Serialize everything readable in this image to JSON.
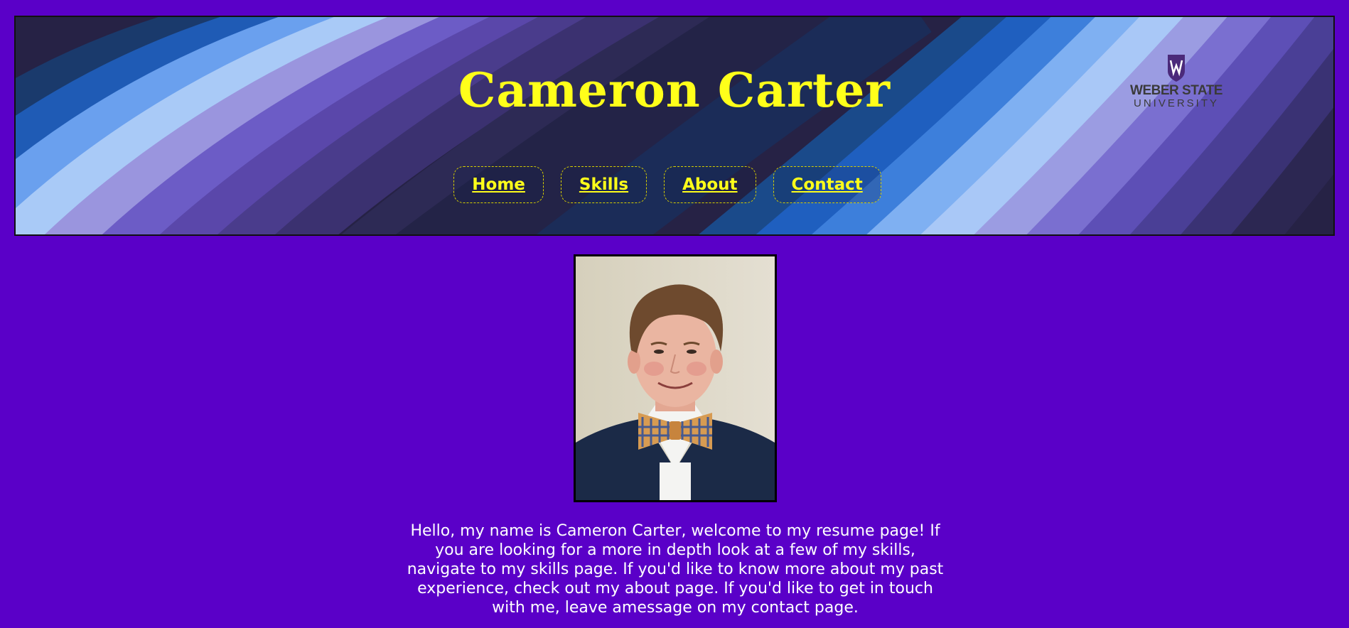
{
  "header": {
    "title": "Cameron Carter",
    "logo": {
      "line1": "WEBER STATE",
      "line2": "UNIVERSITY"
    }
  },
  "nav": {
    "home": "Home",
    "skills": "Skills",
    "about": "About",
    "contact": "Contact"
  },
  "intro": {
    "text": "Hello, my name is Cameron Carter, welcome to my resume page! If you are looking for a more in depth look at a few of my skills, navigate to my skills page. If you'd like to know more about my past experience, check out my about page. If you'd like to get in touch with me, leave amessage on my contact page."
  },
  "colors": {
    "page_background": "#5a00c8",
    "title_yellow": "#ffff1a"
  }
}
